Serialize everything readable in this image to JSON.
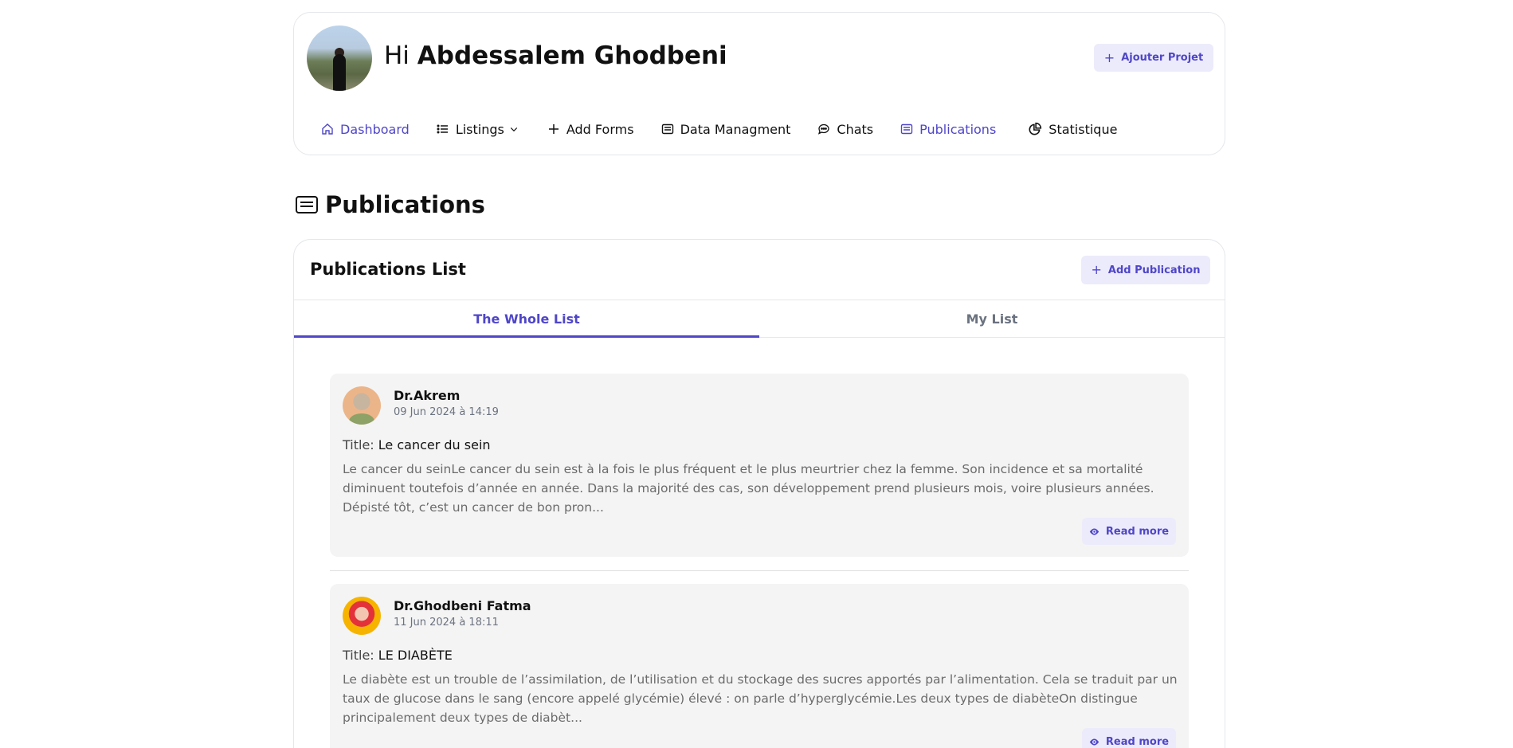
{
  "header": {
    "greeting_hi": "Hi",
    "greeting_name": "Abdessalem Ghodbeni",
    "add_project_label": "Ajouter Projet"
  },
  "nav": [
    {
      "label": "Dashboard",
      "icon": "home-icon",
      "active": true
    },
    {
      "label": "Listings",
      "icon": "list-icon",
      "active": false
    },
    {
      "label": "Add Forms",
      "icon": "plus-icon",
      "active": false
    },
    {
      "label": "Data Managment",
      "icon": "data-icon",
      "active": false
    },
    {
      "label": "Chats",
      "icon": "chat-icon",
      "active": false
    },
    {
      "label": "Publications",
      "icon": "publications-icon",
      "active": true
    },
    {
      "label": "Statistique",
      "icon": "pie-chart-icon",
      "active": false
    }
  ],
  "page": {
    "title": "Publications"
  },
  "list": {
    "title": "Publications List",
    "add_label": "Add Publication",
    "tabs": [
      {
        "label": "The Whole List",
        "active": true
      },
      {
        "label": "My List",
        "active": false
      }
    ]
  },
  "posts": [
    {
      "author": "Dr.Akrem",
      "date": "09 Jun 2024 à 14:19",
      "title_prefix": "Title:",
      "title": "Le cancer du sein",
      "body": "Le cancer du seinLe cancer du sein est à la fois le plus fréquent et le plus meurtrier chez la femme. Son incidence et sa mortalité diminuent toutefois d’année en année. Dans la majorité des cas, son développement prend plusieurs mois, voire plusieurs années. Dépisté tôt, c’est un cancer de bon pron...",
      "read_more": "Read more"
    },
    {
      "author": "Dr.Ghodbeni Fatma",
      "date": "11 Jun 2024 à 18:11",
      "title_prefix": "Title:",
      "title": "LE DIABÈTE",
      "body": "Le diabète est un trouble de l’assimilation, de l’utilisation et du stockage des sucres apportés par l’alimentation. Cela se traduit par un taux de glucose dans le sang (encore appelé glycémie) élevé : on parle d’hyperglycémie.Les deux types de diabèteOn distingue principalement deux types de diabèt...",
      "read_more": "Read more"
    }
  ],
  "colors": {
    "accent": "#4f46c8",
    "accent_soft": "#ecebfb",
    "card_bg": "#f4f4f4",
    "border": "#e5e7eb"
  }
}
